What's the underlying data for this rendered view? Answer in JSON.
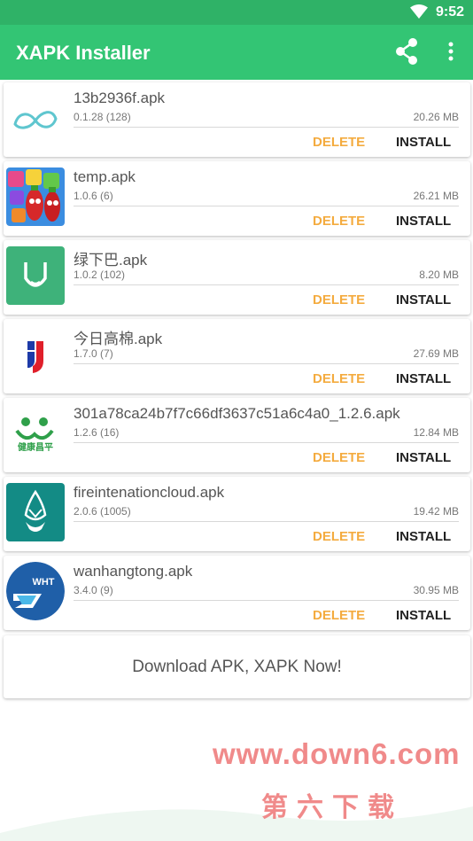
{
  "status": {
    "time": "9:52"
  },
  "appbar": {
    "title": "XAPK Installer"
  },
  "apps": [
    {
      "name": "13b2936f.apk",
      "version": "0.1.28 (128)",
      "size": "20.26 MB",
      "icon": "infinity-logo-icon"
    },
    {
      "name": "temp.apk",
      "version": "1.0.6 (6)",
      "size": "26.21 MB",
      "icon": "candy-game-icon"
    },
    {
      "name": "绿下巴.apk",
      "version": "1.0.2 (102)",
      "size": "8.20 MB",
      "icon": "green-chin-icon"
    },
    {
      "name": "今日高棉.apk",
      "version": "1.7.0 (7)",
      "size": "27.69 MB",
      "icon": "red-blue-j-icon"
    },
    {
      "name": "301a78ca24b7f7c66df3637c51a6c4a0_1.2.6.apk",
      "version": "1.2.6 (16)",
      "size": "12.84 MB",
      "icon": "health-people-icon"
    },
    {
      "name": "fireintenationcloud.apk",
      "version": "2.0.6 (1005)",
      "size": "19.42 MB",
      "icon": "phoenix-shield-icon"
    },
    {
      "name": "wanhangtong.apk",
      "version": "3.4.0 (9)",
      "size": "30.95 MB",
      "icon": "wht-logo-icon"
    }
  ],
  "actions": {
    "delete_label": "DELETE",
    "install_label": "INSTALL"
  },
  "download_banner": "Download APK, XAPK Now!",
  "watermark": {
    "url": "www.down6.com",
    "text": "第六下载"
  },
  "icon_texts": {
    "health": "健康昌平",
    "wht": "WHT"
  },
  "colors": {
    "appbar": "#33c574",
    "statusbar": "#2fb267",
    "delete": "#f4ab3f",
    "install": "#222222"
  }
}
